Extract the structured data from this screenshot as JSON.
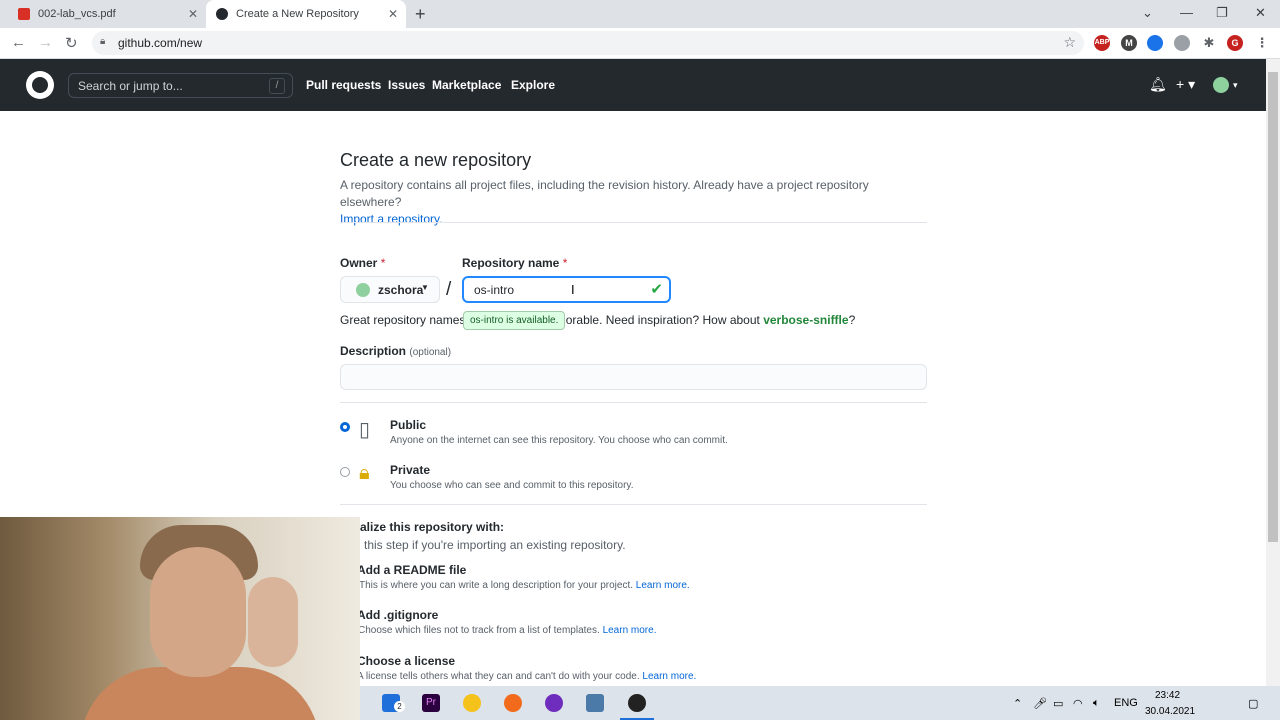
{
  "browser": {
    "tabs": [
      {
        "title": "002-lab_vcs.pdf",
        "active": false
      },
      {
        "title": "Create a New Repository",
        "active": true
      }
    ],
    "url": "github.com/new",
    "profile_initial": "G"
  },
  "gh_header": {
    "search_placeholder": "Search or jump to...",
    "search_shortcut": "/",
    "nav": [
      "Pull requests",
      "Issues",
      "Marketplace",
      "Explore"
    ]
  },
  "form": {
    "title": "Create a new repository",
    "intro": "A repository contains all project files, including the revision history. Already have a project repository elsewhere?",
    "import_link": "Import a repository.",
    "owner_label": "Owner",
    "owner_value": "zschora",
    "repo_label": "Repository name",
    "required_mark": "*",
    "repo_value": "os-intro",
    "separator": "/",
    "hint_prefix": "Great repository names",
    "hint_mid": "orable. Need inspiration? How about",
    "hint_suggestion": "verbose-sniffle",
    "hint_suffix": "?",
    "availability_tooltip": "os-intro is available.",
    "description_label": "Description",
    "description_optional": "(optional)",
    "description_value": "",
    "visibility": [
      {
        "label": "Public",
        "note": "Anyone on the internet can see this repository. You choose who can commit.",
        "selected": true
      },
      {
        "label": "Private",
        "note": "You choose who can see and commit to this repository.",
        "selected": false
      }
    ],
    "init_heading": "alize this repository with:",
    "init_skip": "this step if you're importing an existing repository.",
    "init_options": [
      {
        "label": "Add a README file",
        "note": "This is where you can write a long description for your project.",
        "link": "Learn more."
      },
      {
        "label": "Add .gitignore",
        "note": "Choose which files not to track from a list of templates.",
        "link": "Learn more."
      },
      {
        "label": "Choose a license",
        "note": "A license tells others what they can and can't do with your code.",
        "link": "Learn more."
      }
    ]
  },
  "taskbar": {
    "mail_badge": "2",
    "language": "ENG",
    "time": "23:42",
    "date": "30.04.2021"
  },
  "colors": {
    "gh_header": "#24292e",
    "link": "#0366d6",
    "success": "#28a745"
  }
}
